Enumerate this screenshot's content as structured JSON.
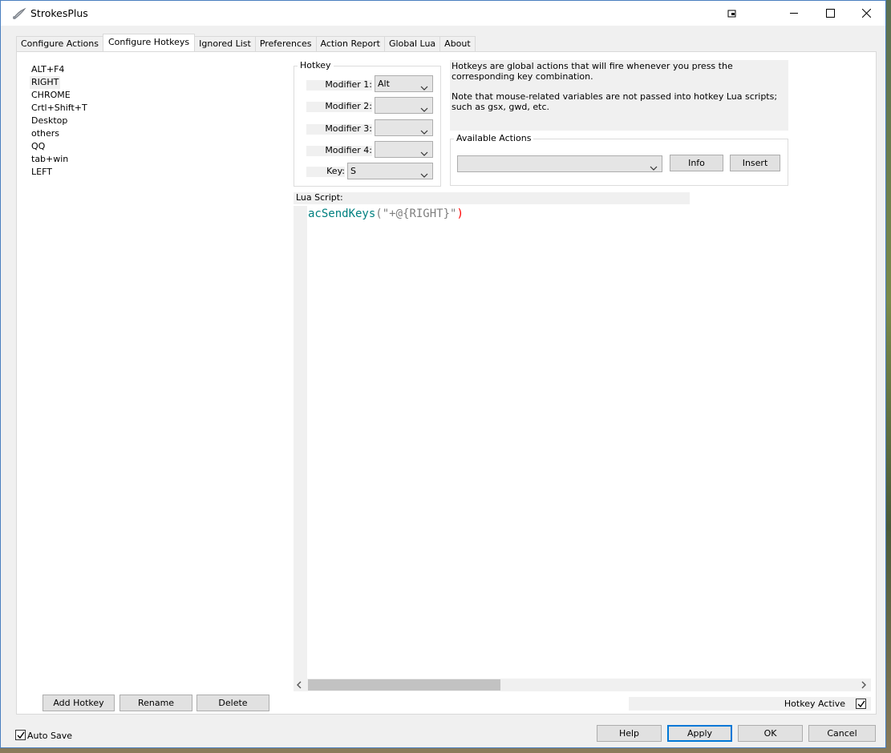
{
  "window": {
    "title": "StrokesPlus",
    "app_icon": "brush-icon",
    "controls": [
      "restore-window-icon",
      "minimize-icon",
      "maximize-icon",
      "close-icon"
    ]
  },
  "tabs": [
    {
      "label": "Configure Actions"
    },
    {
      "label": "Configure Hotkeys",
      "active": true
    },
    {
      "label": "Ignored List"
    },
    {
      "label": "Preferences"
    },
    {
      "label": "Action Report"
    },
    {
      "label": "Global Lua"
    },
    {
      "label": "About"
    }
  ],
  "hotkeys": {
    "items": [
      "ALT+F4",
      "RIGHT",
      "CHROME",
      "Crtl+Shift+T",
      "Desktop",
      "others",
      "QQ",
      "tab+win",
      "LEFT"
    ],
    "selected": "RIGHT"
  },
  "hotkey_group": {
    "legend": "Hotkey",
    "modifier1_label": "Modifier 1:",
    "modifier1_value": "Alt",
    "modifier2_label": "Modifier 2:",
    "modifier2_value": "",
    "modifier3_label": "Modifier 3:",
    "modifier3_value": "",
    "modifier4_label": "Modifier 4:",
    "modifier4_value": "",
    "key_label": "Key:",
    "key_value": "S"
  },
  "help": {
    "line1": "Hotkeys are global actions that will fire whenever you press the corresponding key combination.",
    "line2": "Note that mouse-related variables are not passed into hotkey Lua scripts; such as gsx, gwd, etc."
  },
  "available_actions": {
    "legend": "Available Actions",
    "selected": "",
    "info_label": "Info",
    "insert_label": "Insert"
  },
  "lua": {
    "label": "Lua Script:",
    "fn": "acSendKeys",
    "open": "(",
    "arg": "\"+@{RIGHT}\"",
    "close": ")"
  },
  "list_buttons": {
    "add": "Add Hotkey",
    "rename": "Rename",
    "delete": "Delete"
  },
  "hotkey_active": {
    "label": "Hotkey Active",
    "checked": true
  },
  "footer": {
    "auto_save_label": "Auto Save",
    "auto_save_checked": true,
    "help": "Help",
    "apply": "Apply",
    "ok": "OK",
    "cancel": "Cancel"
  },
  "colors": {
    "accent": "#0078d7",
    "lua_function": "#008080",
    "lua_close_paren": "#ff0000"
  }
}
